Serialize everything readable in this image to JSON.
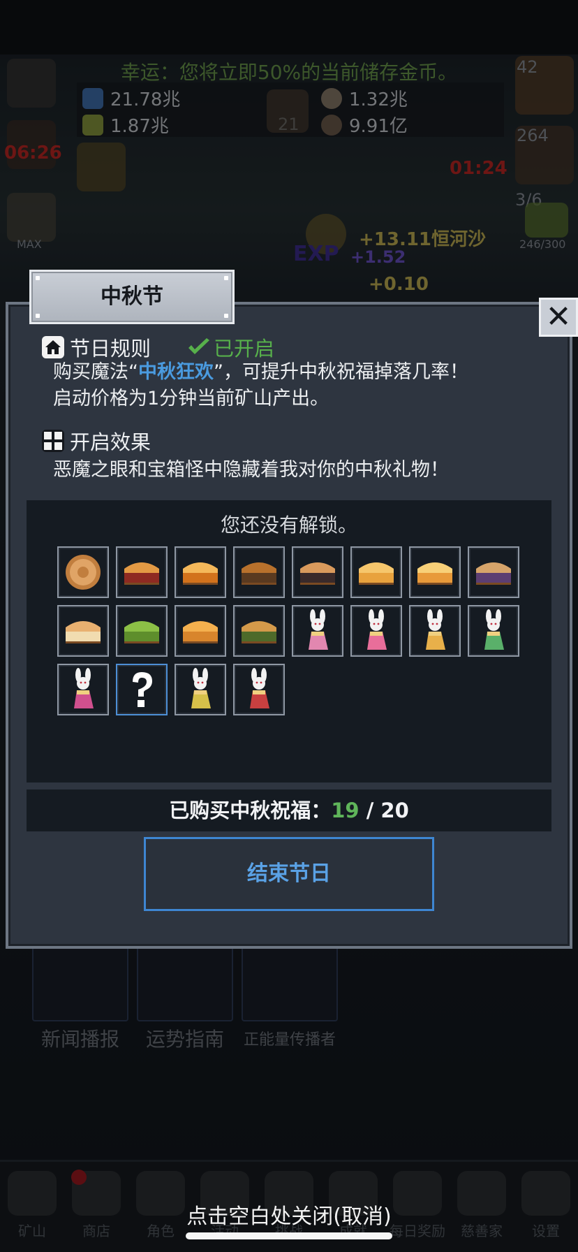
{
  "hud": {
    "luck_text": "幸运：您将立即50%的当前储存金币。",
    "resources": [
      {
        "icon": "blue-potion-icon",
        "value": "21.78兆"
      },
      {
        "icon": "green-potion-icon",
        "value": "1.87兆"
      },
      {
        "icon": "coin-pouch-icon",
        "value": "1.32兆"
      },
      {
        "icon": "ore-icon",
        "value": "9.91亿"
      }
    ],
    "book_level": "21",
    "timer_left": "06:26",
    "timer_right": "01:24",
    "left_max_label": "MAX",
    "potion_count": "42",
    "chest_count": "264",
    "slime_fraction": "3/6",
    "slime_progress": "246/300",
    "gain_gold": "+13.11恒河沙",
    "exp_label": "EXP",
    "exp_gain": "+1.52",
    "gain_small": "+0.10"
  },
  "background_cards": [
    "新闻播报",
    "运势指南",
    "正能量传播者"
  ],
  "bottom_tabs": [
    "矿山",
    "商店",
    "角色",
    "活动",
    "挑战",
    "成就",
    "每日奖励",
    "慈善家",
    "设置"
  ],
  "close_hint": "点击空白处关闭(取消)",
  "modal": {
    "title": "中秋节",
    "close_symbol": "✕",
    "rules_heading": "节日规则",
    "status_text": "已开启",
    "rules_line1_prefix": "购买魔法“",
    "rules_line1_highlight": "中秋狂欢",
    "rules_line1_suffix": "”，可提升中秋祝福掉落几率！",
    "rules_line2": "启动价格为1分钟当前矿山产出。",
    "effect_heading": "开启效果",
    "effect_text": "恶魔之眼和宝箱怪中隐藏着我对你的中秋礼物！",
    "locked_text": "您还没有解锁。",
    "collectibles": [
      "mooncake-round-icon",
      "mooncake-red-icon",
      "mooncake-orange-icon",
      "mooncake-dots-icon",
      "mooncake-dark-icon",
      "mooncake-golden-icon",
      "mooncake-yellow-icon",
      "mooncake-purple-icon",
      "mooncake-cream-icon",
      "mooncake-green-icon",
      "mooncake-amber-icon",
      "mooncake-matcha-icon",
      "rabbit-pink-icon",
      "rabbit-rose-icon",
      "rabbit-gold-icon",
      "rabbit-green-icon",
      "rabbit-magenta-icon",
      "question-mark-icon",
      "rabbit-yellow-icon",
      "rabbit-red-icon"
    ],
    "purchased_label": "已购买中秋祝福：",
    "purchased_count": "19",
    "purchased_sep": " / ",
    "purchased_total": "20",
    "end_button": "结束节日"
  },
  "colors": {
    "accent_blue": "#4a9be0",
    "status_green": "#57b04b",
    "count_green": "#5fb55a",
    "timer_red": "#c4231e"
  }
}
